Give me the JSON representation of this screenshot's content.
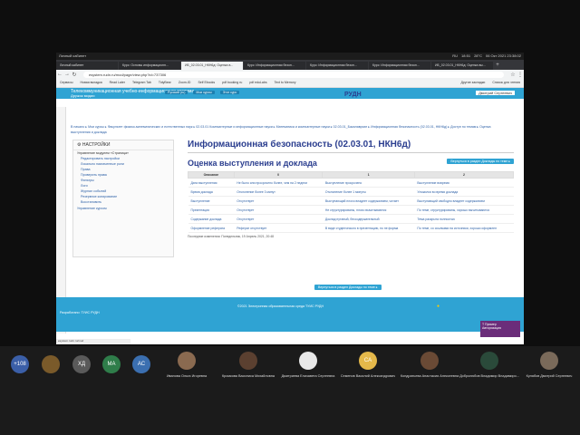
{
  "os": {
    "left": "Личный кабинет",
    "tray": [
      "RU",
      "18:51",
      "28°C",
      "06 Окт 2021 23:38:02"
    ]
  },
  "browser": {
    "tabs": [
      "Личный кабинет",
      "Курс: Основы информационн...",
      "ИБ_02.03.01_НКН6д: Оценка в...",
      "Курс: Информационная безоп...",
      "Курс: Информационная безоп...",
      "Курс: Информационная безоп...",
      "ИБ_02.03.01_НКН6д: Оценка вы..."
    ],
    "url": "esystem.rudn.ru/mod/page/view.php?id=737306",
    "bookmarks": [
      "Сервисы",
      "Новая вкладка",
      "Read Later",
      "Telegram Tab",
      "TidyBear",
      "Zoom-ID",
      "Self Ebooks",
      "pdf booking ru",
      "pdf eduLabs",
      "Text to Memory"
    ],
    "bookmarks_right": [
      "Другие закладки",
      "Список для чтения"
    ]
  },
  "site": {
    "title": "Телекоммуникационная учебно-информационная система",
    "subtitle": "Дружок мидии",
    "menu": [
      "Русский (ru)",
      "Мои курсы",
      "Этот курс"
    ],
    "user": "Дмитрий Сергеевич",
    "logo": "РУДН"
  },
  "breadcrumb": "В начало ▸ Мои курсы ▸ Факультет физико-математических и естественных наук ▸ 02.03.01 Компьютерные и информационные науки ▸ Математика и компьютерные науки ▸ 02.03.01_Бакалавриат ▸ Информационная безопасность (02.03.01, НКН6д) ▸ Доступ по темам ▸ Оценка выступления и доклада",
  "settings": {
    "title": "НАСТРОЙКИ",
    "group": "Управление модулем «Страница»",
    "items": [
      "Редактировать настройки",
      "Локально назначенные роли",
      "Права",
      "Проверить права",
      "Фильтры",
      "Логи",
      "Журнал событий",
      "Резервное копирование",
      "Восстановить"
    ],
    "footer": "Управление курсом"
  },
  "main": {
    "page_title": "Информационная безопасность (02.03.01, НКН6д)",
    "sub_title": "Оценка выступления и доклада",
    "button": "Вернуться в раздел Доклады по теме ▸",
    "table": {
      "headers": [
        "Описание",
        "0",
        "1",
        "2"
      ],
      "rows": [
        [
          "Дата выступления",
          "Не было или просрочено более, чем на 2 недели",
          "Выступление просрочено",
          "Выступление вовремя"
        ],
        [
          "Время доклада",
          "Отклонение более 3 минут",
          "Отклонение более 1 минуты",
          "Уложился во время доклада"
        ],
        [
          "Выступление",
          "Отсутствует",
          "Выступающий плохо владеет содержанием, читает",
          "Выступающий свободно владеет содержанием"
        ],
        [
          "Презентация",
          "Отсутствует",
          "Не структурированы, плохо вычитываются",
          "По теме, структурированы, хорошо вычитываются"
        ],
        [
          "Содержание доклада",
          "Отсутствует",
          "Доклад путаный, бессодержательный",
          "Тема раскрыта полностью"
        ],
        [
          "Оформление реферата",
          "Реферат отсутствует",
          "В виде студенческого в презентацию, но не форма",
          "По теме, со ссылками на источники, хорошо оформлен"
        ]
      ]
    },
    "last_modified": "Последние изменения: Понедельник, 19 Апрель 2021, 20:48"
  },
  "footer": {
    "copyright": "©2021 Электронная образовательная среда ТУИС РУДН",
    "watermark": "Разработано: ТУИС РУДН"
  },
  "popup": {
    "title": "T Пример",
    "text": "Авторизация"
  },
  "status": "esystem.rudn.ru/mod",
  "conference": {
    "initials": [
      "+108",
      "ХД",
      "МА",
      "АС",
      "СА"
    ],
    "participants": [
      "Иванова Ольга Игоревна",
      "Кромкова Василиса Михайловна",
      "Дмитриева Елизавета Сергеевна",
      "Семенов Василий Александрович",
      "Кондратьева Анастасия Алексеевна",
      "Добролюбов Владимир Владимиро...",
      "Кулябов Дмитрий Сергеевич"
    ]
  }
}
